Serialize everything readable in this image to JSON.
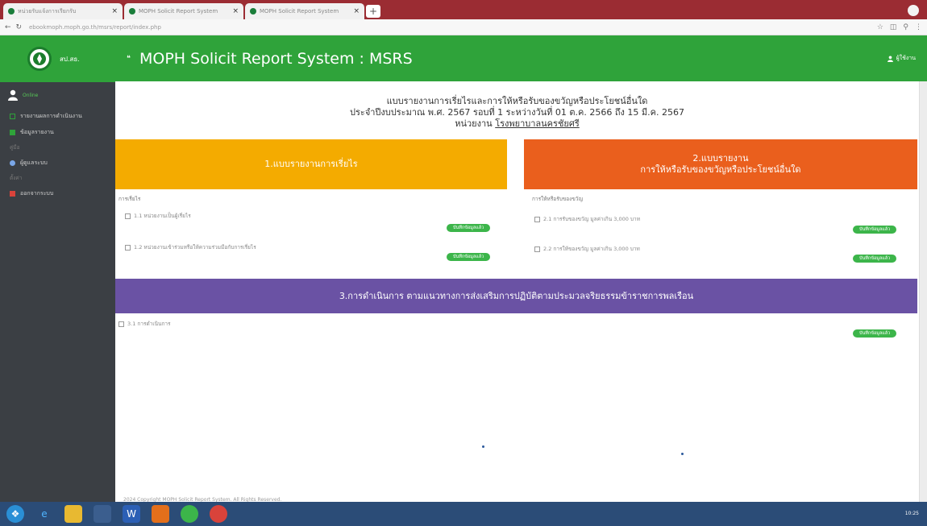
{
  "browser": {
    "tabs": [
      {
        "label": "หน่วยรับแจ้งการเรียกรับ"
      },
      {
        "label": "MOPH Solicit Report System"
      },
      {
        "label": "MOPH Solicit Report System"
      }
    ],
    "url": "ebookmoph.moph.go.th/msrs/report/index.php"
  },
  "sidebar": {
    "logo_text": "สป.สธ.",
    "user_name": "Online",
    "menu": [
      {
        "label": "รายงานผลการดำเนินงาน",
        "color": "#2fa33a"
      },
      {
        "label": "ข้อมูลรายงาน",
        "color": "#2fa33a"
      },
      {
        "label": "ผู้ดูแลระบบ",
        "color": "#7aa7e8"
      },
      {
        "label": "ออกจากระบบ",
        "color": "#d9433b"
      }
    ],
    "menu_heads": [
      "คู่มือ",
      "ตั้งค่า"
    ]
  },
  "header": {
    "title": "MOPH Solicit Report System : MSRS",
    "user": "ผู้ใช้งาน"
  },
  "intro": {
    "line1": "แบบรายงานการเรี่ยไรและการให้หรือรับของขวัญหรือประโยชน์อื่นใด",
    "line2": "ประจำปีงบประมาณ พ.ศ. 2567 รอบที่ 1 ระหว่างวันที่ 01 ต.ค. 2566 ถึง 15 มี.ค. 2567",
    "unit_label": "หน่วยงาน",
    "unit_name": "โรงพยาบาลนครชัยศรี"
  },
  "panels": {
    "p1": {
      "title": "1.แบบรายงานการเรี่ยไร"
    },
    "p2": {
      "title_line1": "2.แบบรายงาน",
      "title_line2": "การให้หรือรับของขวัญหรือประโยชน์อื่นใด"
    },
    "p3": {
      "title": "3.การดำเนินการ ตามแนวทางการส่งเสริมการปฏิบัติตามประมวลจริยธรรมข้าราชการพลเรือน"
    }
  },
  "section1": {
    "label": "การเรี่ยไร",
    "items": [
      "1.1 หน่วยงานเป็นผู้เรี่ยไร",
      "1.2 หน่วยงานเข้าร่วมหรือให้ความร่วมมือกับการเรี่ยไร"
    ]
  },
  "section2": {
    "label": "การให้หรือรับของขวัญ",
    "items": [
      "2.1 การรับของขวัญ มูลค่าเกิน 3,000 บาท",
      "2.2 การให้ของขวัญ มูลค่าเกิน 3,000 บาท"
    ]
  },
  "section3": {
    "items": [
      "3.1 การดำเนินการ"
    ]
  },
  "save_label": "บันทึกข้อมูลแล้ว",
  "footer": "2024 Copyright MOPH Solicit Report System. All Rights Reserved.",
  "taskbar": {
    "clock": "10:25"
  }
}
